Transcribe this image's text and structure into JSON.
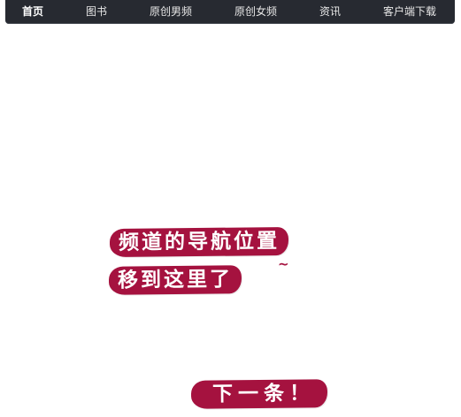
{
  "nav": {
    "items": [
      {
        "label": "首页"
      },
      {
        "label": "图书"
      },
      {
        "label": "原创男频"
      },
      {
        "label": "原创女频"
      },
      {
        "label": "资讯"
      },
      {
        "label": "客户端下载"
      }
    ]
  },
  "tip": {
    "line1": "频道的导航位置",
    "line2": "移到这里了",
    "tilde": "~",
    "next_label": "下一条！"
  },
  "colors": {
    "navbar_bg": "#272a31",
    "bubble": "#a5123f"
  }
}
